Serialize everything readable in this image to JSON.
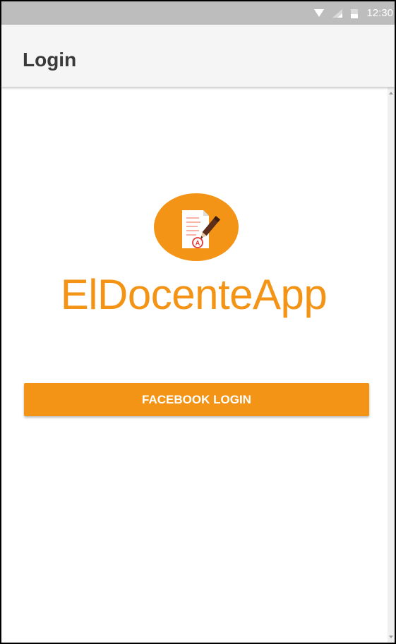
{
  "status_bar": {
    "time": "12:30",
    "icons": [
      "wifi-icon",
      "signal-icon",
      "battery-icon"
    ]
  },
  "app_bar": {
    "title": "Login"
  },
  "logo": {
    "icon": "graded-document-icon",
    "name": "ElDocenteApp"
  },
  "facebook_button": {
    "label": "FACEBOOK LOGIN"
  },
  "colors": {
    "accent": "#f39416",
    "status_bar": "#bdbdbd",
    "app_bar": "#f5f5f5",
    "title_text": "#3a3a3a"
  }
}
